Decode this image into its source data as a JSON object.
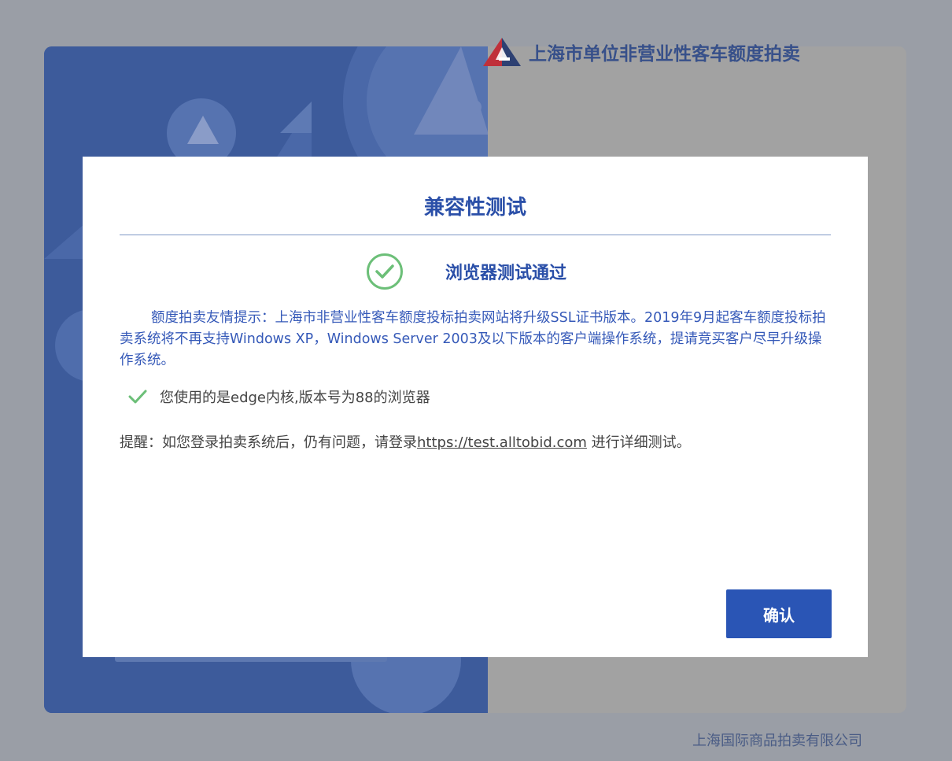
{
  "background": {
    "brand_title": "上海市单位非营业性客车额度拍卖",
    "footer_company": "上海国际商品拍卖有限公司"
  },
  "dialog": {
    "title": "兼容性测试",
    "pass_message": "浏览器测试通过",
    "notice": "额度拍卖友情提示：上海市非营业性客车额度投标拍卖网站将升级SSL证书版本。2019年9月起客车额度投标拍卖系统将不再支持Windows XP，Windows Server 2003及以下版本的客户端操作系统，提请竞买客户尽早升级操作系统。",
    "browser_info": "您使用的是edge内核,版本号为88的浏览器",
    "reminder_prefix": "提醒：如您登录拍卖系统后，仍有问题，请登录",
    "reminder_link": "https://test.alltobid.com",
    "reminder_suffix": " 进行详细测试。",
    "confirm_label": "确认"
  },
  "colors": {
    "accent": "#2a55b5",
    "title_blue": "#2a4fa8",
    "success_green": "#6cbf78"
  },
  "icons": {
    "pass": "check-circle-icon",
    "browser_ok": "check-icon",
    "brand": "sail-logo-icon"
  }
}
